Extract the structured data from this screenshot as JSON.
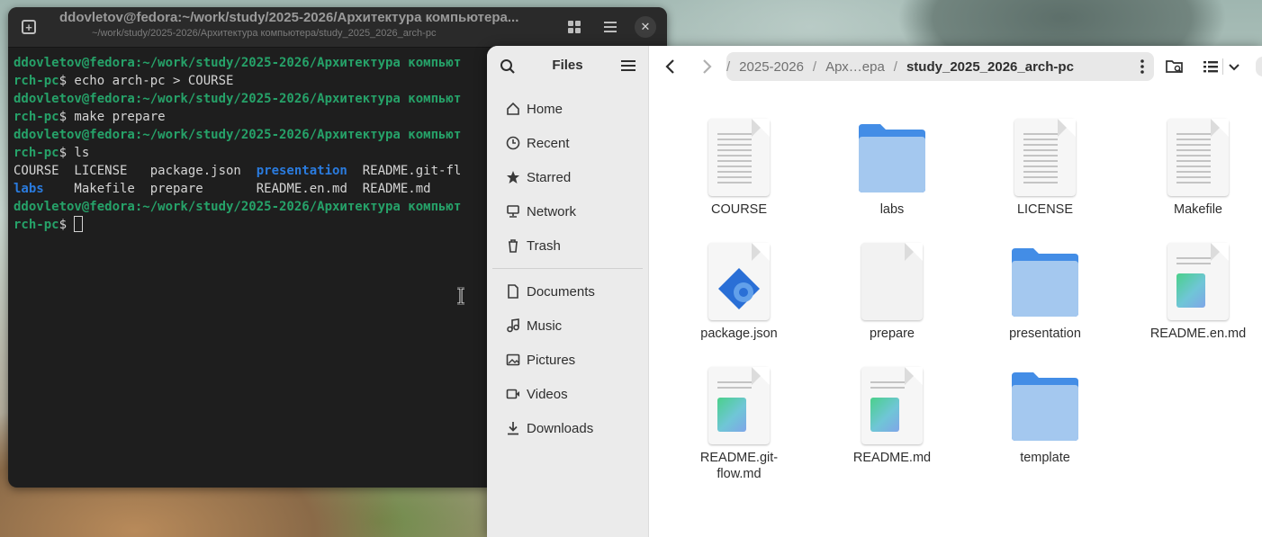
{
  "terminal": {
    "title": "ddovletov@fedora:~/work/study/2025-2026/Архитектура компьютера...",
    "subtitle": "~/work/study/2025-2026/Архитектура компьютера/study_2025_2026_arch-pc",
    "lines": {
      "l1_user": "ddovletov@fedora",
      "l1_path": ":~/work/study/2025-2026/Архитектура компьют",
      "l2_path": "rch-pc",
      "l2_cmd": "$ echo arch-pc > COURSE",
      "l3_user": "ddovletov@fedora",
      "l3_path": ":~/work/study/2025-2026/Архитектура компьют",
      "l4_path": "rch-pc",
      "l4_cmd": "$ make prepare",
      "l5_user": "ddovletov@fedora",
      "l5_path": ":~/work/study/2025-2026/Архитектура компьют",
      "l6_path": "rch-pc",
      "l6_cmd": "$ ls",
      "ls1_a": "COURSE  LICENSE   package.json  ",
      "ls1_dir": "presentation",
      "ls1_b": "  README.git-fl",
      "ls2_dir": "labs",
      "ls2_b": "    Makefile  prepare       README.en.md  README.md",
      "l9_user": "ddovletov@fedora",
      "l9_path": ":~/work/study/2025-2026/Архитектура компьют",
      "l10_path": "rch-pc",
      "l10_cmd": "$ "
    }
  },
  "files": {
    "sidebar": {
      "title": "Files",
      "places": [
        {
          "label": "Home",
          "icon": "home-icon"
        },
        {
          "label": "Recent",
          "icon": "clock-icon"
        },
        {
          "label": "Starred",
          "icon": "star-icon"
        },
        {
          "label": "Network",
          "icon": "network-icon"
        },
        {
          "label": "Trash",
          "icon": "trash-icon"
        }
      ],
      "bookmarks": [
        {
          "label": "Documents",
          "icon": "document-icon"
        },
        {
          "label": "Music",
          "icon": "music-icon"
        },
        {
          "label": "Pictures",
          "icon": "picture-icon"
        },
        {
          "label": "Videos",
          "icon": "video-icon"
        },
        {
          "label": "Downloads",
          "icon": "download-icon"
        }
      ]
    },
    "path": {
      "seg1": "2025-2026",
      "seg2": "Арх…ера",
      "current": "study_2025_2026_arch-pc",
      "separator": "/"
    },
    "items": [
      {
        "name": "COURSE",
        "type": "text"
      },
      {
        "name": "labs",
        "type": "folder"
      },
      {
        "name": "LICENSE",
        "type": "text"
      },
      {
        "name": "Makefile",
        "type": "text"
      },
      {
        "name": "package.json",
        "type": "json"
      },
      {
        "name": "prepare",
        "type": "blank"
      },
      {
        "name": "presentation",
        "type": "folder"
      },
      {
        "name": "README.en.md",
        "type": "markdown"
      },
      {
        "name": "README.git-flow.md",
        "type": "markdown"
      },
      {
        "name": "README.md",
        "type": "markdown"
      },
      {
        "name": "template",
        "type": "folder"
      }
    ]
  },
  "colors": {
    "prompt_green": "#26a269",
    "dir_blue": "#2a7bde",
    "folder_blue": "#438de6",
    "folder_light": "#a4c8ef"
  }
}
